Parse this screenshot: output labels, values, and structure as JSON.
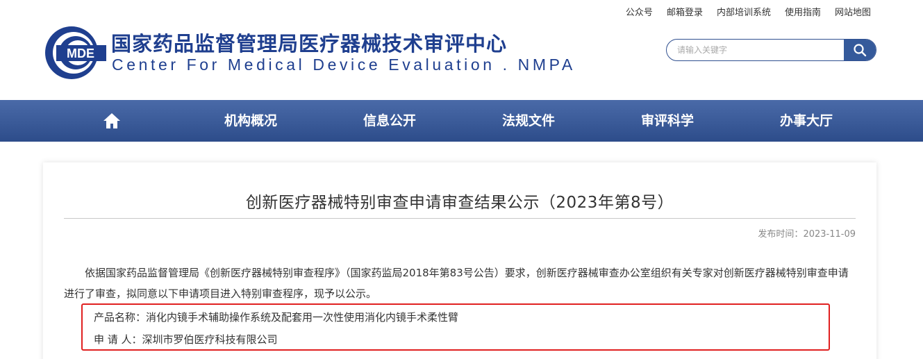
{
  "top_links": [
    "公众号",
    "邮箱登录",
    "内部培训系统",
    "使用指南",
    "网站地图"
  ],
  "logo": {
    "mark_text": "MDE"
  },
  "brand": {
    "name_cn": "国家药品监督管理局医疗器械技术审评中心",
    "name_en": "Center For Medical Device Evaluation . NMPA"
  },
  "search": {
    "placeholder": "请输入关键字",
    "icon": "search-icon"
  },
  "nav": {
    "home_icon": "home-icon",
    "items": [
      "机构概况",
      "信息公开",
      "法规文件",
      "审评科学",
      "办事大厅"
    ]
  },
  "article": {
    "title": "创新医疗器械特别审查申请审查结果公示（2023年第8号）",
    "publish_label": "发布时间：",
    "publish_date": "2023-11-09",
    "body": "依据国家药品监督管理局《创新医疗器械特别审查程序》（国家药监局2018年第83号公告）要求，创新医疗器械审查办公室组织有关专家对创新医疗器械特别审查申请进行了审查，拟同意以下申请项目进入特别审查程序，现予以公示。",
    "product_label": "产品名称：",
    "product_name": "消化内镜手术辅助操作系统及配套用一次性使用消化内镜手术柔性臂",
    "applicant_label": "申 请 人：",
    "applicant_name": "深圳市罗伯医疗科技有限公司"
  },
  "colors": {
    "brand_blue": "#1f3f8f",
    "nav_blue": "#3a5a98",
    "highlight_red": "#e02020"
  }
}
